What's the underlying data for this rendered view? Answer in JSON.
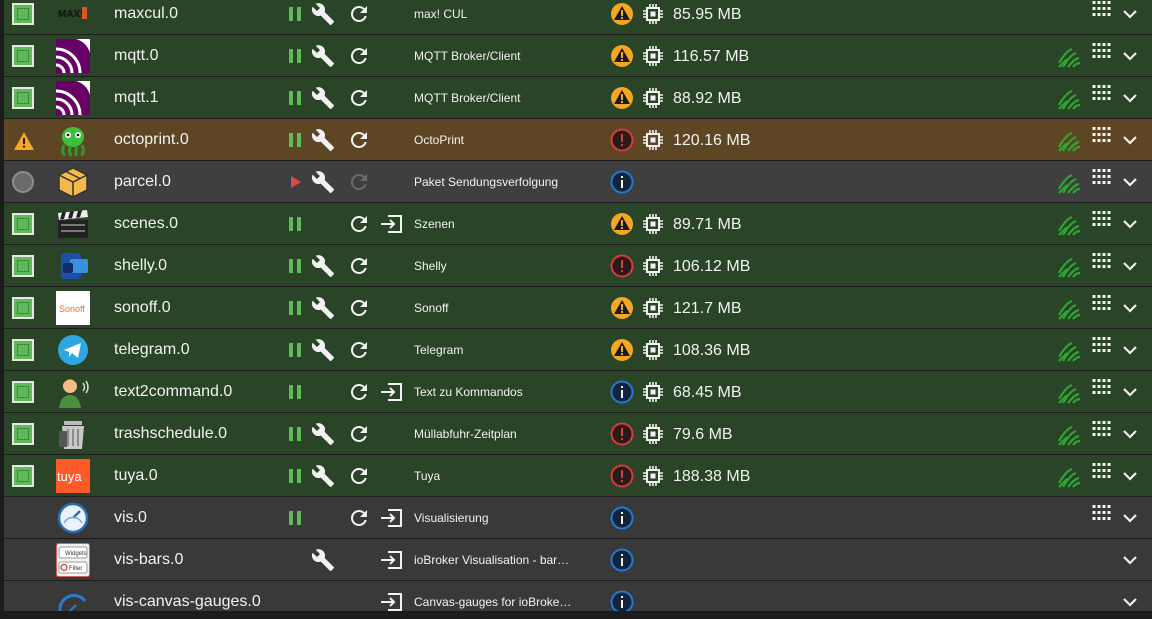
{
  "colors": {
    "running_bg": "#2a4427",
    "warning_bg": "#5e4624",
    "stopped_bg": "#3f3f3f",
    "accent_green": "#5fb85a",
    "warn_level": "#f5a623",
    "error_level": "#d83b3b",
    "info_level": "#1e7bd6"
  },
  "adapters": [
    {
      "name": "maxcul.0",
      "title": "max! CUL",
      "memory": "85.95 MB",
      "logo": "maxcul-logo",
      "row": "run",
      "status": "running",
      "pause": true,
      "wrench": true,
      "restart": true,
      "link": false,
      "level": "warn",
      "connected": false,
      "grid": true,
      "logo_text": "MAX!"
    },
    {
      "name": "mqtt.0",
      "title": "MQTT Broker/Client",
      "memory": "116.57 MB",
      "logo": "mqtt-logo",
      "row": "run",
      "status": "running",
      "pause": true,
      "wrench": true,
      "restart": true,
      "link": false,
      "level": "warn",
      "connected": true,
      "grid": true
    },
    {
      "name": "mqtt.1",
      "title": "MQTT Broker/Client",
      "memory": "88.92 MB",
      "logo": "mqtt-logo",
      "row": "run",
      "status": "running",
      "pause": true,
      "wrench": true,
      "restart": true,
      "link": false,
      "level": "warn",
      "connected": true,
      "grid": true
    },
    {
      "name": "octoprint.0",
      "title": "OctoPrint",
      "memory": "120.16 MB",
      "logo": "octoprint-logo",
      "row": "warn",
      "status": "warning",
      "pause": true,
      "wrench": true,
      "restart": true,
      "link": false,
      "level": "error",
      "connected": true,
      "grid": true
    },
    {
      "name": "parcel.0",
      "title": "Paket Sendungsverfolgung",
      "memory": "",
      "logo": "parcel-logo",
      "row": "stop",
      "status": "stopped",
      "pause": false,
      "wrench": true,
      "restart": "disabled",
      "link": false,
      "level": "info",
      "connected": true,
      "grid": true
    },
    {
      "name": "scenes.0",
      "title": "Szenen",
      "memory": "89.71 MB",
      "logo": "scenes-logo",
      "row": "run",
      "status": "running",
      "pause": true,
      "wrench": false,
      "restart": true,
      "link": true,
      "level": "warn",
      "connected": true,
      "grid": true
    },
    {
      "name": "shelly.0",
      "title": "Shelly",
      "memory": "106.12 MB",
      "logo": "shelly-logo",
      "row": "run",
      "status": "running",
      "pause": true,
      "wrench": true,
      "restart": true,
      "link": false,
      "level": "error",
      "connected": true,
      "grid": true
    },
    {
      "name": "sonoff.0",
      "title": "Sonoff",
      "memory": "121.7 MB",
      "logo": "sonoff-logo",
      "row": "run",
      "status": "running",
      "pause": true,
      "wrench": true,
      "restart": true,
      "link": false,
      "level": "warn",
      "connected": true,
      "grid": true,
      "logo_text": "Sonoff"
    },
    {
      "name": "telegram.0",
      "title": "Telegram",
      "memory": "108.36 MB",
      "logo": "telegram-logo",
      "row": "run",
      "status": "running",
      "pause": true,
      "wrench": true,
      "restart": true,
      "link": false,
      "level": "warn",
      "connected": true,
      "grid": true
    },
    {
      "name": "text2command.0",
      "title": "Text zu Kommandos",
      "memory": "68.45 MB",
      "logo": "text2command-logo",
      "row": "run",
      "status": "running",
      "pause": true,
      "wrench": false,
      "restart": true,
      "link": true,
      "level": "info",
      "connected": true,
      "grid": true
    },
    {
      "name": "trashschedule.0",
      "title": "Müllabfuhr-Zeitplan",
      "memory": "79.6 MB",
      "logo": "trashschedule-logo",
      "row": "run",
      "status": "running",
      "pause": true,
      "wrench": true,
      "restart": true,
      "link": false,
      "level": "error",
      "connected": true,
      "grid": true
    },
    {
      "name": "tuya.0",
      "title": "Tuya",
      "memory": "188.38 MB",
      "logo": "tuya-logo",
      "row": "run",
      "status": "running",
      "pause": true,
      "wrench": true,
      "restart": true,
      "link": false,
      "level": "error",
      "connected": true,
      "grid": true,
      "logo_text": "tuya"
    },
    {
      "name": "vis.0",
      "title": "Visualisierung",
      "memory": "",
      "logo": "vis-logo",
      "row": "none",
      "status": "none",
      "pause": true,
      "wrench": false,
      "restart": true,
      "link": true,
      "level": "info",
      "connected": false,
      "grid": true
    },
    {
      "name": "vis-bars.0",
      "title": "ioBroker Visualisation - bar…",
      "memory": "",
      "logo": "vis-bars-logo",
      "row": "none",
      "status": "none",
      "pause": false,
      "wrench": true,
      "restart": false,
      "link": true,
      "level": "info",
      "connected": false,
      "grid": false,
      "logo_text": [
        "Widgets",
        "Filter"
      ]
    },
    {
      "name": "vis-canvas-gauges.0",
      "title": "Canvas-gauges for ioBroke…",
      "memory": "",
      "logo": "vis-canvas-gauges-logo",
      "row": "none",
      "status": "none",
      "pause": false,
      "wrench": false,
      "restart": false,
      "link": true,
      "level": "info",
      "connected": false,
      "grid": false
    }
  ]
}
